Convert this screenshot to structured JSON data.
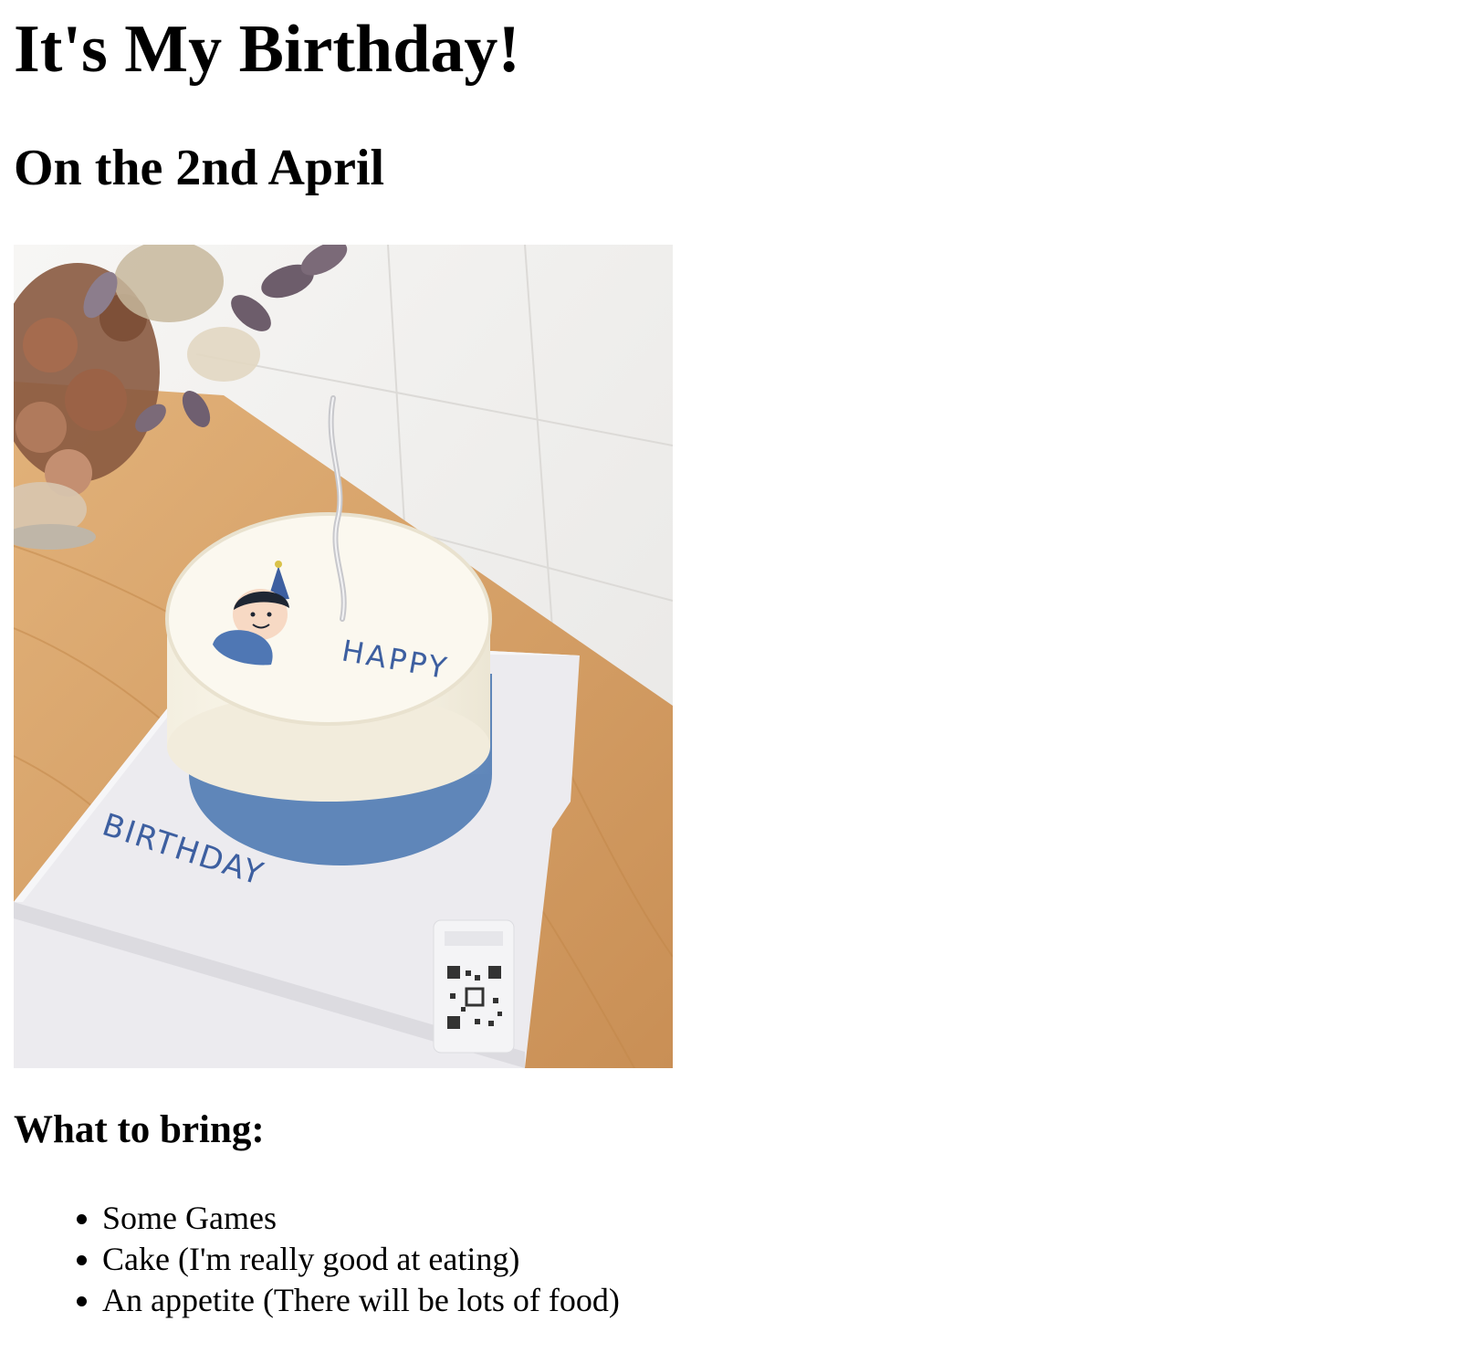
{
  "header": {
    "title": "It's My Birthday!",
    "date_line": "On the 2nd April"
  },
  "photo": {
    "icon": "birthday-cake-photo",
    "cake_text_top": "HAPPY",
    "cake_text_board": "BIRTHDAY",
    "colors": {
      "wall": "#f3f2f0",
      "table": "#d9a66b",
      "board": "#ecebef",
      "cake_cream": "#f8f4e8",
      "cake_blue": "#6f97c9",
      "lettering": "#3d5fa0"
    }
  },
  "bring": {
    "heading": "What to bring:",
    "items": [
      "Some Games",
      "Cake (I'm really good at eating)",
      "An appetite (There will be lots of food)"
    ]
  }
}
